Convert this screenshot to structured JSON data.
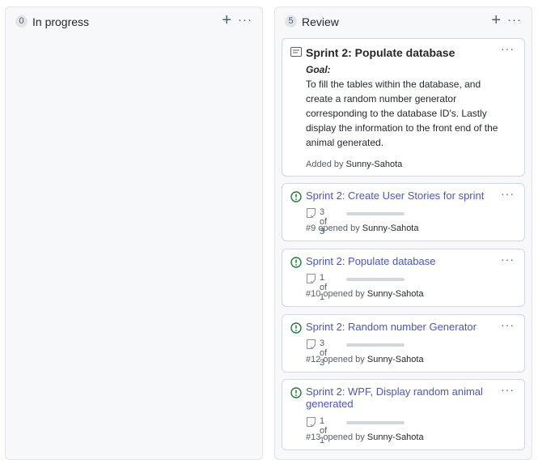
{
  "columns": [
    {
      "title": "In progress",
      "count": "0",
      "add_icon": "plus-icon",
      "menu_icon": "kebab-icon",
      "cards": []
    },
    {
      "title": "Review",
      "count": "5",
      "add_icon": "plus-icon",
      "menu_icon": "kebab-icon",
      "note": {
        "icon": "note-icon",
        "title": "Sprint 2: Populate database",
        "goal_label": "Goal:",
        "body": "To fill the tables within the database, and create a random number generator corresponding to the database ID's. Lastly display the information to the front end of the animal generated.",
        "added_prefix": "Added by",
        "added_by": "Sunny-Sahota"
      },
      "issues": [
        {
          "title": "Sprint 2: Create User Stories for sprint",
          "tasks": "3 of 3",
          "progress": 1.0,
          "number": "#9",
          "opened_prefix": "opened by",
          "author": "Sunny-Sahota"
        },
        {
          "title": "Sprint 2: Populate database",
          "tasks": "1 of 1",
          "progress": 1.0,
          "number": "#10",
          "opened_prefix": "opened by",
          "author": "Sunny-Sahota"
        },
        {
          "title": "Sprint 2: Random number Generator",
          "tasks": "3 of 3",
          "progress": 1.0,
          "number": "#12",
          "opened_prefix": "opened by",
          "author": "Sunny-Sahota"
        },
        {
          "title": "Sprint 2: WPF, Display random animal generated",
          "tasks": "1 of 1",
          "progress": 1.0,
          "number": "#13",
          "opened_prefix": "opened by",
          "author": "Sunny-Sahota"
        }
      ]
    }
  ],
  "colors": {
    "issue_open": "#1a7f37",
    "link": "#4a56c8",
    "column_bg": "#f6f8fa",
    "border": "#d0d7de"
  }
}
